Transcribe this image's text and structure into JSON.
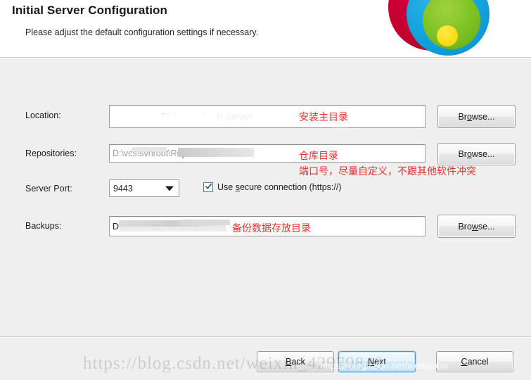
{
  "header": {
    "title": "Initial Server Configuration",
    "subtitle": "Please adjust the default configuration settings if necessary.",
    "logo_name": "visualsvn-logo",
    "logo_colors": {
      "outer_red": "#c3002f",
      "blue": "#13a3dd",
      "green": "#7cc124",
      "yellow": "#fcdc14"
    }
  },
  "form": {
    "location": {
      "label": "Location:",
      "value": "C:\\Program Files\\VisualSVN Server\\",
      "browse_label": "Browse...",
      "browse_accel": "o",
      "annotation": "安装主目录"
    },
    "repositories": {
      "label": "Repositories:",
      "value": "D:\\vcs\\svnroot\\Rep               \\",
      "browse_label": "Browse...",
      "browse_accel": "o",
      "annotation": "仓库目录"
    },
    "server_port": {
      "label": "Server Port:",
      "value": "9443",
      "options": [
        "9443"
      ],
      "annotation": "端口号，尽量自定义，不跟其他软件冲突"
    },
    "secure_connection": {
      "label": "Use secure connection (https://)",
      "checked": true,
      "accel": "s"
    },
    "backups": {
      "label": "Backups:",
      "value": "D:\\vcs\\svnroot\\Backup",
      "browse_label": "Browse...",
      "browse_accel": "w",
      "annotation": "备份数据存放目录"
    }
  },
  "footer": {
    "back_label": "Back",
    "back_accel": "B",
    "next_label": "Next",
    "next_accel": "N",
    "cancel_label": "Cancel",
    "cancel_accel": "C",
    "focused_button": "Next"
  },
  "watermarks": {
    "large": "https://blog.csdn.net/weixin_42979840",
    "small": "https://blog.csdn.net/weihaobo"
  },
  "colors": {
    "annotation_red": "#ef2c2c",
    "dialog_background": "#efefef",
    "header_background": "#ffffff",
    "focus_blue": "#3c9bdb"
  }
}
